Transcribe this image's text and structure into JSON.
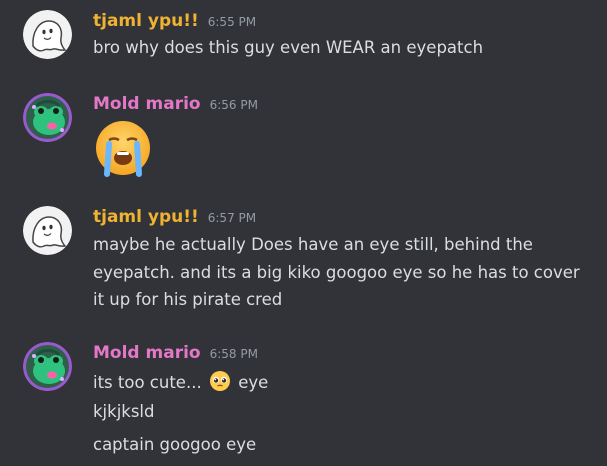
{
  "colors": {
    "background": "#313338",
    "text": "#dbdee1",
    "timestamp": "#949ba4",
    "user_tjaml": "#f0b232",
    "user_mold": "#e478c8"
  },
  "messages": [
    {
      "author": "tjaml ypu!!",
      "time": "6:55 PM",
      "avatar_icon": "ghost-avatar-icon",
      "lines": [
        "bro why does this guy even WEAR an eyepatch"
      ]
    },
    {
      "author": "Mold mario",
      "time": "6:56 PM",
      "avatar_icon": "frog-avatar-icon",
      "emoji": "loudly-crying-face-emoji"
    },
    {
      "author": "tjaml ypu!!",
      "time": "6:57 PM",
      "avatar_icon": "ghost-avatar-icon",
      "text": "maybe he actually Does have an eye still, behind the eyepatch. and its a big kiko googoo eye so he has to cover it up for his pirate cred"
    },
    {
      "author": "Mold mario",
      "time": "6:58 PM",
      "avatar_icon": "frog-avatar-icon",
      "line1_before": "its too cute...",
      "line1_emoji": "pleading-face-emoji",
      "line1_after": "eye",
      "line2": "kjkjksld",
      "line3": "captain googoo eye"
    }
  ]
}
